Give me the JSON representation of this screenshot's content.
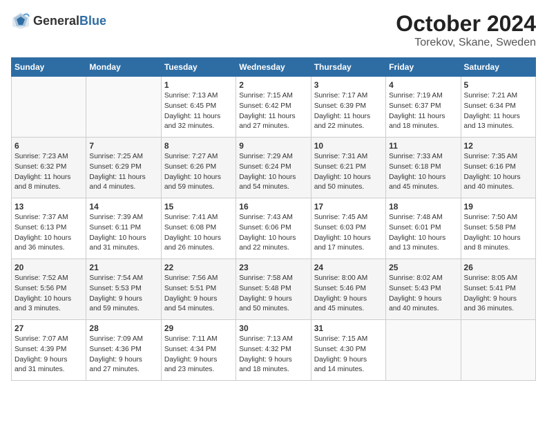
{
  "logo": {
    "general": "General",
    "blue": "Blue"
  },
  "title": "October 2024",
  "subtitle": "Torekov, Skane, Sweden",
  "weekdays": [
    "Sunday",
    "Monday",
    "Tuesday",
    "Wednesday",
    "Thursday",
    "Friday",
    "Saturday"
  ],
  "weeks": [
    [
      {
        "day": "",
        "content": ""
      },
      {
        "day": "",
        "content": ""
      },
      {
        "day": "1",
        "content": "Sunrise: 7:13 AM\nSunset: 6:45 PM\nDaylight: 11 hours\nand 32 minutes."
      },
      {
        "day": "2",
        "content": "Sunrise: 7:15 AM\nSunset: 6:42 PM\nDaylight: 11 hours\nand 27 minutes."
      },
      {
        "day": "3",
        "content": "Sunrise: 7:17 AM\nSunset: 6:39 PM\nDaylight: 11 hours\nand 22 minutes."
      },
      {
        "day": "4",
        "content": "Sunrise: 7:19 AM\nSunset: 6:37 PM\nDaylight: 11 hours\nand 18 minutes."
      },
      {
        "day": "5",
        "content": "Sunrise: 7:21 AM\nSunset: 6:34 PM\nDaylight: 11 hours\nand 13 minutes."
      }
    ],
    [
      {
        "day": "6",
        "content": "Sunrise: 7:23 AM\nSunset: 6:32 PM\nDaylight: 11 hours\nand 8 minutes."
      },
      {
        "day": "7",
        "content": "Sunrise: 7:25 AM\nSunset: 6:29 PM\nDaylight: 11 hours\nand 4 minutes."
      },
      {
        "day": "8",
        "content": "Sunrise: 7:27 AM\nSunset: 6:26 PM\nDaylight: 10 hours\nand 59 minutes."
      },
      {
        "day": "9",
        "content": "Sunrise: 7:29 AM\nSunset: 6:24 PM\nDaylight: 10 hours\nand 54 minutes."
      },
      {
        "day": "10",
        "content": "Sunrise: 7:31 AM\nSunset: 6:21 PM\nDaylight: 10 hours\nand 50 minutes."
      },
      {
        "day": "11",
        "content": "Sunrise: 7:33 AM\nSunset: 6:18 PM\nDaylight: 10 hours\nand 45 minutes."
      },
      {
        "day": "12",
        "content": "Sunrise: 7:35 AM\nSunset: 6:16 PM\nDaylight: 10 hours\nand 40 minutes."
      }
    ],
    [
      {
        "day": "13",
        "content": "Sunrise: 7:37 AM\nSunset: 6:13 PM\nDaylight: 10 hours\nand 36 minutes."
      },
      {
        "day": "14",
        "content": "Sunrise: 7:39 AM\nSunset: 6:11 PM\nDaylight: 10 hours\nand 31 minutes."
      },
      {
        "day": "15",
        "content": "Sunrise: 7:41 AM\nSunset: 6:08 PM\nDaylight: 10 hours\nand 26 minutes."
      },
      {
        "day": "16",
        "content": "Sunrise: 7:43 AM\nSunset: 6:06 PM\nDaylight: 10 hours\nand 22 minutes."
      },
      {
        "day": "17",
        "content": "Sunrise: 7:45 AM\nSunset: 6:03 PM\nDaylight: 10 hours\nand 17 minutes."
      },
      {
        "day": "18",
        "content": "Sunrise: 7:48 AM\nSunset: 6:01 PM\nDaylight: 10 hours\nand 13 minutes."
      },
      {
        "day": "19",
        "content": "Sunrise: 7:50 AM\nSunset: 5:58 PM\nDaylight: 10 hours\nand 8 minutes."
      }
    ],
    [
      {
        "day": "20",
        "content": "Sunrise: 7:52 AM\nSunset: 5:56 PM\nDaylight: 10 hours\nand 3 minutes."
      },
      {
        "day": "21",
        "content": "Sunrise: 7:54 AM\nSunset: 5:53 PM\nDaylight: 9 hours\nand 59 minutes."
      },
      {
        "day": "22",
        "content": "Sunrise: 7:56 AM\nSunset: 5:51 PM\nDaylight: 9 hours\nand 54 minutes."
      },
      {
        "day": "23",
        "content": "Sunrise: 7:58 AM\nSunset: 5:48 PM\nDaylight: 9 hours\nand 50 minutes."
      },
      {
        "day": "24",
        "content": "Sunrise: 8:00 AM\nSunset: 5:46 PM\nDaylight: 9 hours\nand 45 minutes."
      },
      {
        "day": "25",
        "content": "Sunrise: 8:02 AM\nSunset: 5:43 PM\nDaylight: 9 hours\nand 40 minutes."
      },
      {
        "day": "26",
        "content": "Sunrise: 8:05 AM\nSunset: 5:41 PM\nDaylight: 9 hours\nand 36 minutes."
      }
    ],
    [
      {
        "day": "27",
        "content": "Sunrise: 7:07 AM\nSunset: 4:39 PM\nDaylight: 9 hours\nand 31 minutes."
      },
      {
        "day": "28",
        "content": "Sunrise: 7:09 AM\nSunset: 4:36 PM\nDaylight: 9 hours\nand 27 minutes."
      },
      {
        "day": "29",
        "content": "Sunrise: 7:11 AM\nSunset: 4:34 PM\nDaylight: 9 hours\nand 23 minutes."
      },
      {
        "day": "30",
        "content": "Sunrise: 7:13 AM\nSunset: 4:32 PM\nDaylight: 9 hours\nand 18 minutes."
      },
      {
        "day": "31",
        "content": "Sunrise: 7:15 AM\nSunset: 4:30 PM\nDaylight: 9 hours\nand 14 minutes."
      },
      {
        "day": "",
        "content": ""
      },
      {
        "day": "",
        "content": ""
      }
    ]
  ]
}
